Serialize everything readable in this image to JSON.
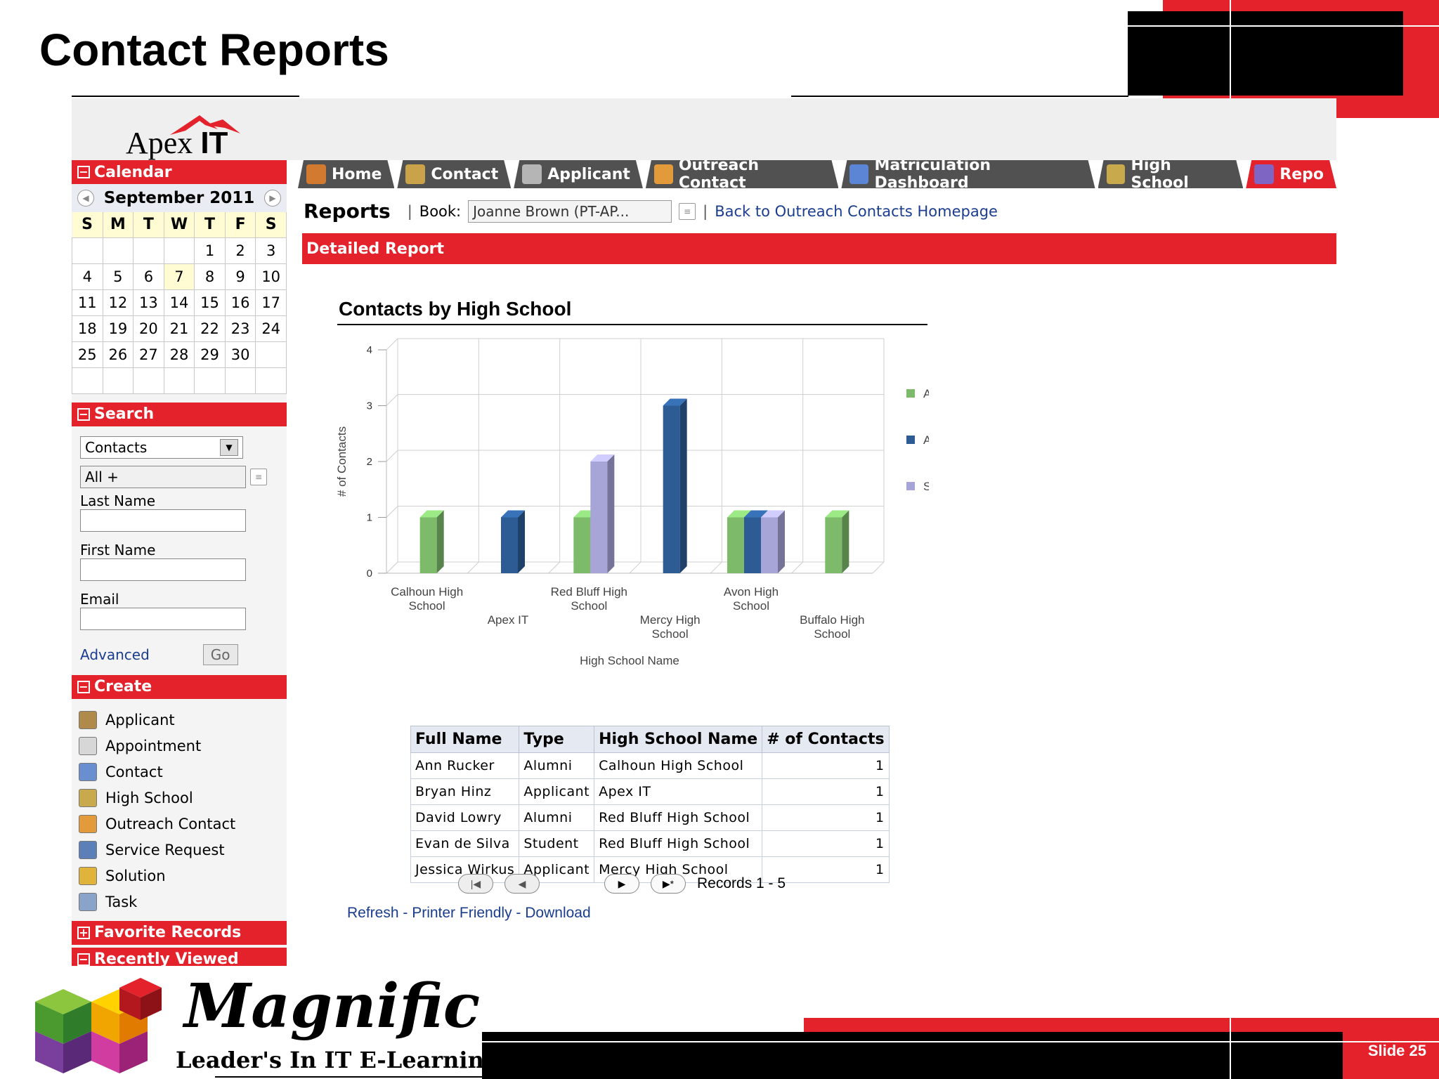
{
  "slide": {
    "title": "Contact Reports",
    "slide_number": "Slide 25",
    "brand_name": "Magnific",
    "brand_tagline": "Leader's In IT E-Learning",
    "accent": "#e3222b"
  },
  "app": {
    "logo_word": "Apex",
    "logo_suffix": "IT"
  },
  "sidebar": {
    "calendar": {
      "header": "Calendar",
      "month": "September 2011",
      "weekdays": [
        "S",
        "M",
        "T",
        "W",
        "T",
        "F",
        "S"
      ],
      "weeks": [
        [
          "",
          "",
          "",
          "",
          "1",
          "2",
          "3"
        ],
        [
          "4",
          "5",
          "6",
          "7",
          "8",
          "9",
          "10"
        ],
        [
          "11",
          "12",
          "13",
          "14",
          "15",
          "16",
          "17"
        ],
        [
          "18",
          "19",
          "20",
          "21",
          "22",
          "23",
          "24"
        ],
        [
          "25",
          "26",
          "27",
          "28",
          "29",
          "30",
          ""
        ],
        [
          "",
          "",
          "",
          "",
          "",
          "",
          ""
        ]
      ],
      "today": "7"
    },
    "search": {
      "header": "Search",
      "type_value": "Contacts",
      "filter_value": "All +",
      "last_name_label": "Last Name",
      "first_name_label": "First Name",
      "email_label": "Email",
      "advanced_label": "Advanced",
      "go_label": "Go"
    },
    "create": {
      "header": "Create",
      "items": [
        {
          "label": "Applicant",
          "icon": "applicant-icon",
          "color": "#b08a4a"
        },
        {
          "label": "Appointment",
          "icon": "appointment-icon",
          "color": "#d7d7d7"
        },
        {
          "label": "Contact",
          "icon": "contact-icon",
          "color": "#6a8fd0"
        },
        {
          "label": "High School",
          "icon": "high-school-icon",
          "color": "#c8a94c"
        },
        {
          "label": "Outreach Contact",
          "icon": "outreach-contact-icon",
          "color": "#e39a3a"
        },
        {
          "label": "Service Request",
          "icon": "service-request-icon",
          "color": "#5d7fb8"
        },
        {
          "label": "Solution",
          "icon": "solution-key-icon",
          "color": "#e0b43a"
        },
        {
          "label": "Task",
          "icon": "task-icon",
          "color": "#8aa3c9"
        }
      ]
    },
    "favorites_header": "Favorite Records",
    "recent_header": "Recently Viewed"
  },
  "tabs": [
    {
      "label": "Home",
      "icon": "home-icon",
      "color": "#d27a2f",
      "active": false
    },
    {
      "label": "Contact",
      "icon": "contact-icon",
      "color": "#c9a24a",
      "active": false
    },
    {
      "label": "Applicant",
      "icon": "applicant-icon",
      "color": "#b5b5b5",
      "active": false
    },
    {
      "label": "Outreach Contact",
      "icon": "outreach-contact-icon",
      "color": "#e39a3a",
      "active": false
    },
    {
      "label": "Matriculation Dashboard",
      "icon": "dashboard-chart-icon",
      "color": "#5d85d6",
      "active": false
    },
    {
      "label": "High School",
      "icon": "high-school-icon",
      "color": "#c8a94c",
      "active": false
    },
    {
      "label": "Repo",
      "icon": "reports-icon",
      "color": "#7e65c4",
      "active": true
    }
  ],
  "toolbar": {
    "title": "Reports",
    "book_label": "Book:",
    "book_value": "Joanne Brown (PT-AP...",
    "back_link": "Back to Outreach Contacts Homepage"
  },
  "report": {
    "bar_title": "Detailed Report",
    "chart_title": "Contacts by High School"
  },
  "chart_data": {
    "type": "bar",
    "title": "Contacts by High School",
    "xlabel": "High School Name",
    "ylabel": "# of Contacts",
    "ylim": [
      0,
      4
    ],
    "yticks": [
      "0",
      "1",
      "2",
      "3",
      "4"
    ],
    "categories": [
      [
        "Calhoun High",
        "School"
      ],
      [
        "Apex IT"
      ],
      [
        "Red Bluff High",
        "School"
      ],
      [
        "Mercy High",
        "School"
      ],
      [
        "Avon High",
        "School"
      ],
      [
        "Buffalo High",
        "School"
      ]
    ],
    "series": [
      {
        "name": "Alumni",
        "color": "#7dbb6b",
        "values": [
          1,
          0,
          1,
          0,
          1,
          1
        ]
      },
      {
        "name": "Applicant",
        "color": "#2d5c94",
        "values": [
          0,
          1,
          0,
          3,
          1,
          0
        ]
      },
      {
        "name": "Student",
        "color": "#a7a4d8",
        "values": [
          0,
          0,
          2,
          0,
          1,
          0
        ]
      }
    ],
    "grid": true,
    "legend": "right"
  },
  "table": {
    "columns": [
      "Full Name",
      "Type",
      "High School Name",
      "# of Contacts"
    ],
    "rows": [
      [
        "Ann Rucker",
        "Alumni",
        "Calhoun High School",
        "1"
      ],
      [
        "Bryan Hinz",
        "Applicant",
        "Apex IT",
        "1"
      ],
      [
        "David Lowry",
        "Alumni",
        "Red Bluff High School",
        "1"
      ],
      [
        "Evan de Silva",
        "Student",
        "Red Bluff High School",
        "1"
      ],
      [
        "Jessica Wirkus",
        "Applicant",
        "Mercy High School",
        "1"
      ]
    ]
  },
  "pager": {
    "records": "Records 1 - 5"
  },
  "footer": {
    "refresh": "Refresh",
    "printer": "Printer Friendly",
    "download": "Download",
    "sep": " - "
  }
}
